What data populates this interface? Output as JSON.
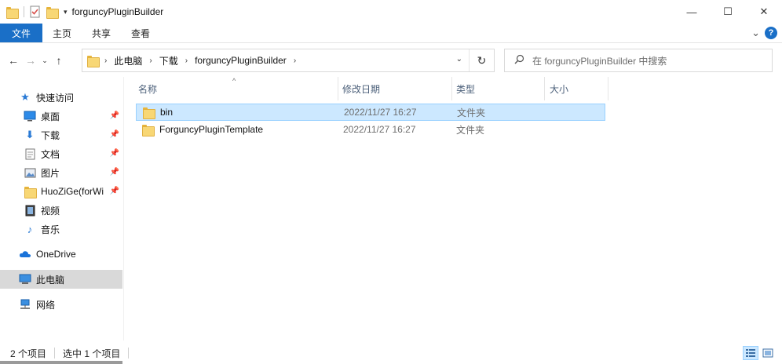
{
  "window": {
    "title": "forguncyPluginBuilder",
    "controls": {
      "minimize": "—",
      "maximize": "☐",
      "close": "✕"
    }
  },
  "ribbon": {
    "file_tab": "文件",
    "tabs": [
      "主页",
      "共享",
      "查看"
    ],
    "expand_glyph": "⌄",
    "help_glyph": "?"
  },
  "address": {
    "crumbs": [
      "此电脑",
      "下载",
      "forguncyPluginBuilder"
    ],
    "refresh_glyph": "↻"
  },
  "search": {
    "placeholder": "在 forguncyPluginBuilder 中搜索"
  },
  "nav_pane": {
    "quick_access": "快速访问",
    "items": [
      {
        "label": "桌面",
        "icon": "desktop-icon",
        "pinned": true
      },
      {
        "label": "下载",
        "icon": "download-icon",
        "pinned": true
      },
      {
        "label": "文档",
        "icon": "document-icon",
        "pinned": true
      },
      {
        "label": "图片",
        "icon": "picture-icon",
        "pinned": true
      },
      {
        "label": "HuoZiGe(forWi",
        "icon": "folder-icon",
        "pinned": true
      },
      {
        "label": "视频",
        "icon": "video-icon",
        "pinned": false
      },
      {
        "label": "音乐",
        "icon": "music-icon",
        "pinned": false
      }
    ],
    "onedrive": "OneDrive",
    "this_pc": "此电脑",
    "network": "网络"
  },
  "file_list": {
    "columns": [
      "名称",
      "修改日期",
      "类型",
      "大小"
    ],
    "rows": [
      {
        "name": "bin",
        "date": "2022/11/27 16:27",
        "type": "文件夹",
        "size": "",
        "selected": true
      },
      {
        "name": "ForguncyPluginTemplate",
        "date": "2022/11/27 16:27",
        "type": "文件夹",
        "size": "",
        "selected": false
      }
    ]
  },
  "status": {
    "item_count": "2 个项目",
    "selected_count": "选中 1 个项目"
  },
  "colors": {
    "accent": "#1a6fc7",
    "selection_bg": "#cce8ff",
    "selection_border": "#99d1ff",
    "folder": "#f8d775"
  }
}
